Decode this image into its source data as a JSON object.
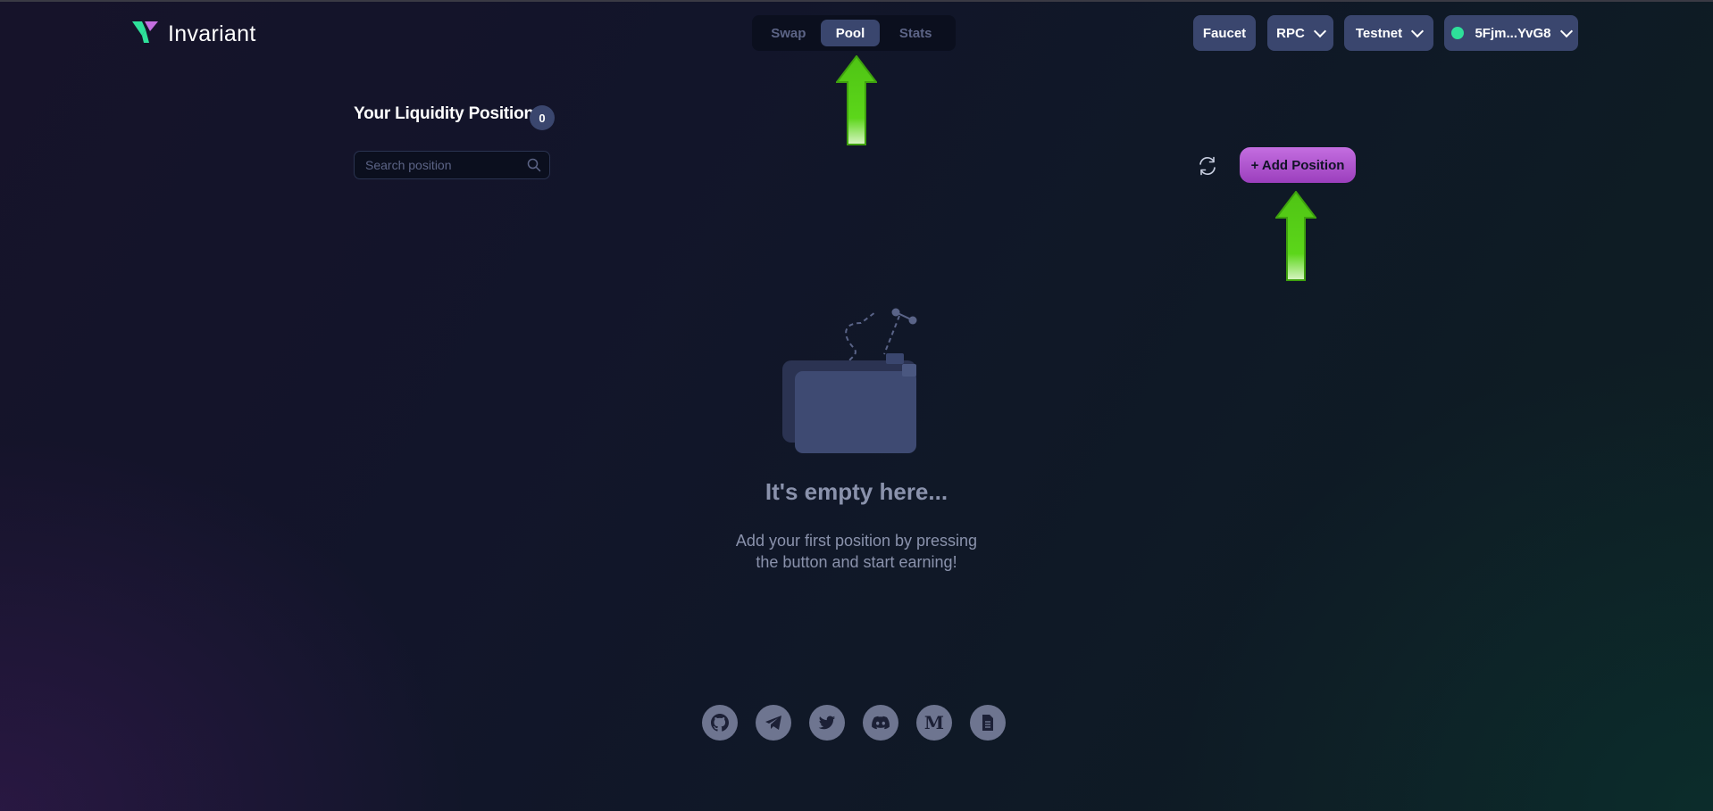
{
  "brand": {
    "name": "Invariant",
    "logo_icon": "invariant-logo-icon"
  },
  "nav": {
    "tabs": [
      {
        "label": "Swap",
        "active": false
      },
      {
        "label": "Pool",
        "active": true
      },
      {
        "label": "Stats",
        "active": false
      }
    ]
  },
  "header": {
    "faucet_label": "Faucet",
    "rpc_label": "RPC",
    "network_label": "Testnet",
    "wallet_address": "5Fjm...YvG8",
    "wallet_status_color": "#2ee09a"
  },
  "positions": {
    "title": "Your Liquidity Positions",
    "count": "0",
    "search_placeholder": "Search position",
    "add_button_label": "+ Add Position"
  },
  "empty_state": {
    "title": "It's empty here...",
    "description_line1": "Add your first position by pressing",
    "description_line2": "the button and start earning!"
  },
  "footer": {
    "socials": [
      "github-icon",
      "telegram-icon",
      "twitter-icon",
      "discord-icon",
      "medium-icon",
      "docs-icon"
    ]
  },
  "colors": {
    "accent_button": "#3a466e",
    "add_position": "#b05ad4",
    "annotation_arrow": "#5cd61a"
  }
}
